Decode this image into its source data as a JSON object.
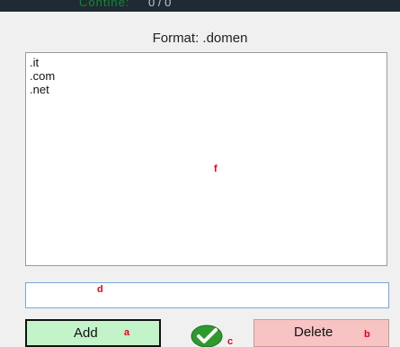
{
  "top_strip": {
    "clipped_text": "Contine:",
    "clipped_text2": "0 / 0"
  },
  "format_label": "Format: .domen",
  "domains": [
    ".it",
    ".com",
    ".net"
  ],
  "markers": {
    "a": "a",
    "b": "b",
    "c": "c",
    "d": "d",
    "f": "f"
  },
  "entry": {
    "value": ""
  },
  "buttons": {
    "add": "Add",
    "delete": "Delete"
  },
  "icons": {
    "confirm": "check-circle-icon"
  },
  "colors": {
    "add_bg": "#c3f3c8",
    "delete_bg": "#f7c3c3",
    "marker": "#e8001c",
    "check": "#2e9a2e"
  }
}
